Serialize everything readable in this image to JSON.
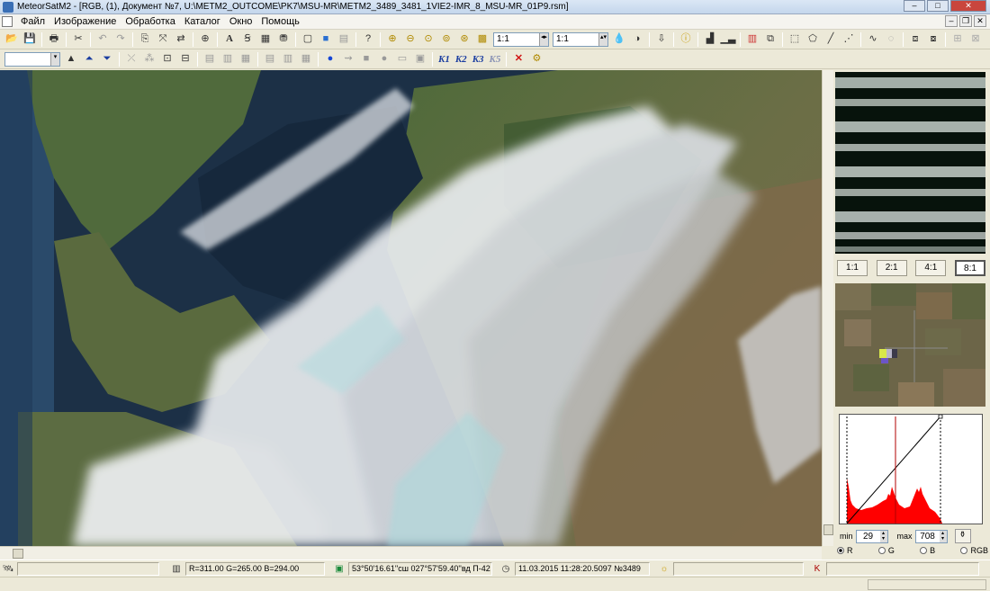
{
  "window": {
    "title": "MeteorSatM2 - [RGB, (1),  Документ №7, U:\\METM2_OUTCOME\\PK7\\MSU-MR\\METM2_3489_3481_1VIE2-IMR_8_MSU-MR_01P9.rsm]",
    "min_label": "–",
    "max_label": "□",
    "close_label": "✕"
  },
  "menu": {
    "items": [
      "Файл",
      "Изображение",
      "Обработка",
      "Каталог",
      "Окно",
      "Помощь"
    ],
    "mdi": [
      "–",
      "❐",
      "✕"
    ]
  },
  "toolbar1": {
    "zoom_value_1": "1:1",
    "zoom_value_2": "1:1",
    "icons": [
      "open-icon",
      "save-icon",
      "print-icon",
      "cut-icon",
      "undo-icon",
      "redo-icon",
      "copy-icon",
      "paste-icon",
      "swap-icon",
      "crosshair-icon",
      "text-icon",
      "textbox-icon",
      "grid-icon",
      "layers-icon",
      "box-icon",
      "cube-icon",
      "doc-icon",
      "help-icon",
      "zoom-in-icon",
      "zoom-out-icon",
      "zoom-fit-icon",
      "zoom-1-icon",
      "zoom-2-icon",
      "grid-select-icon"
    ]
  },
  "toolbar2": {
    "dropdown_value": "",
    "k_labels": [
      "K1",
      "K2",
      "K3",
      "K5"
    ]
  },
  "zoom_buttons": [
    "1:1",
    "2:1",
    "4:1",
    "8:1"
  ],
  "zoom_active": "8:1",
  "histogram": {
    "min_label": "min",
    "min_value": "29",
    "max_label": "max",
    "max_value": "708",
    "channels": [
      "R",
      "G",
      "B",
      "RGB"
    ],
    "selected_channel": "R",
    "colors": {
      "bars": "#ff0000",
      "line": "#000000",
      "marker": "#b00000"
    }
  },
  "status": {
    "field1": "",
    "rgb_values": "R=311.00 G=265.00 B=294.00",
    "coordinates": "53°50'16.61''сш 027°57'59.40''вд П-42",
    "timestamp": "11.03.2015 11:28:20.5097  №3489",
    "field5": "",
    "field6": ""
  }
}
